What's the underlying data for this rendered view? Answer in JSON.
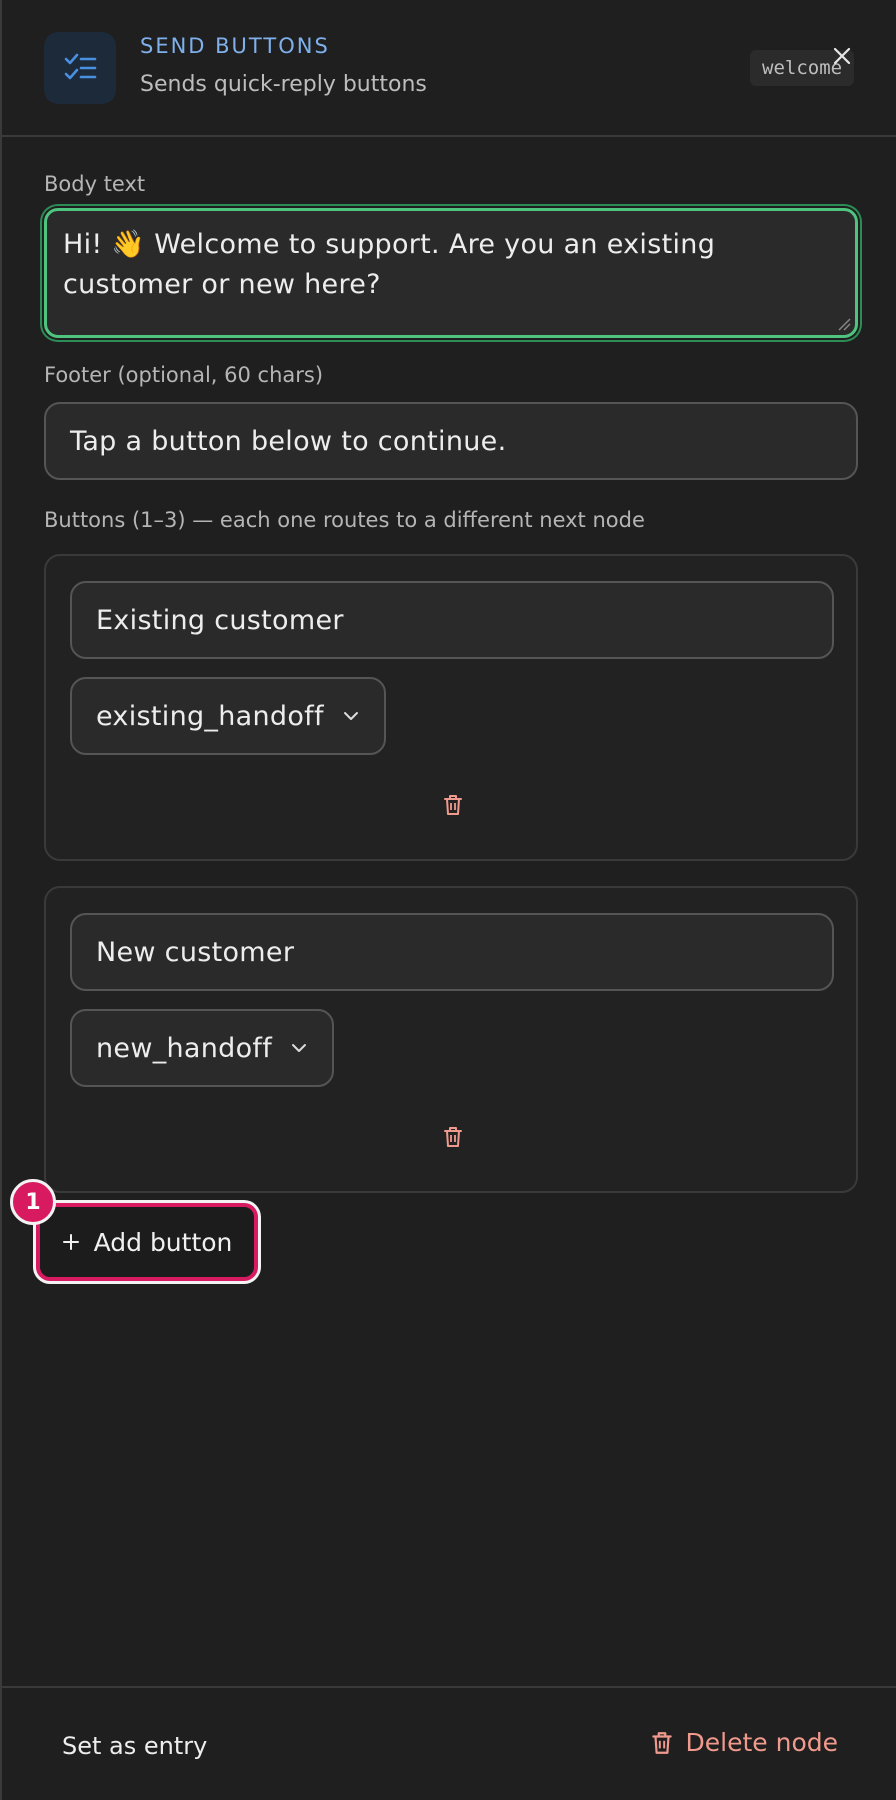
{
  "header": {
    "node_type": "SEND BUTTONS",
    "node_description": "Sends quick-reply buttons",
    "node_id": "welcome",
    "icon": "checklist-icon",
    "close_icon": "close-icon"
  },
  "body": {
    "label": "Body text",
    "value": "Hi! 👋 Welcome to support. Are you an existing customer or new here?"
  },
  "footer_field": {
    "label": "Footer (optional, 60 chars)",
    "value": "Tap a button below to continue."
  },
  "buttons_section": {
    "label": "Buttons (1–3) — each one routes to a different next node",
    "buttons": [
      {
        "title": "Existing customer",
        "route": "existing_handoff"
      },
      {
        "title": "New customer",
        "route": "new_handoff"
      }
    ],
    "add_label": "Add button",
    "badge": "1"
  },
  "actions": {
    "set_entry": "Set as entry",
    "delete_node": "Delete node"
  },
  "colors": {
    "accent_blue": "#7fb0ec",
    "focus_green": "#4ec47e",
    "danger": "#f09a8e",
    "highlight": "#d81b60"
  }
}
